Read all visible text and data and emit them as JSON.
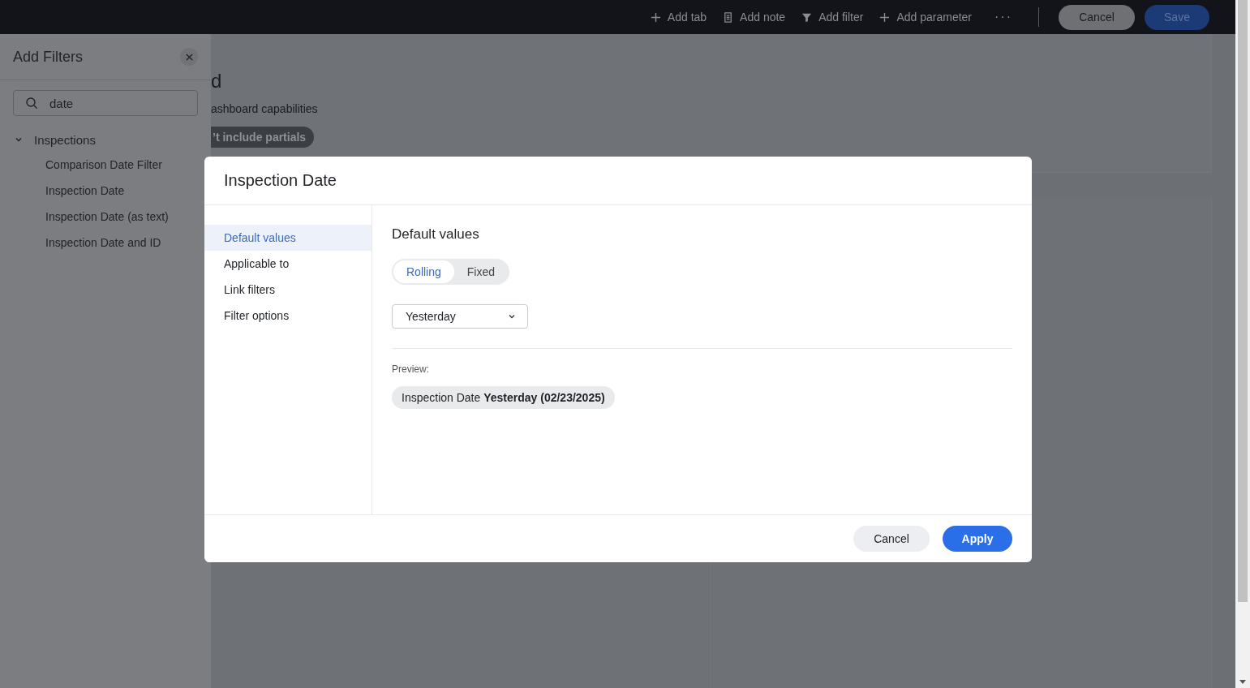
{
  "toolbar": {
    "actions": [
      {
        "kind": "plus",
        "label": "Add tab"
      },
      {
        "kind": "note",
        "label": "Add note"
      },
      {
        "kind": "filter",
        "label": "Add filter"
      },
      {
        "kind": "plus",
        "label": "Add parameter"
      }
    ],
    "more": "···",
    "cancel": "Cancel",
    "save": "Save"
  },
  "sidebar": {
    "title": "Add Filters",
    "search": {
      "value": "date"
    },
    "tree": [
      {
        "label": "Inspections",
        "expanded": true,
        "children": [
          {
            "label": "Comparison Date Filter"
          },
          {
            "label": "Inspection Date"
          },
          {
            "label": "Inspection Date (as text)"
          },
          {
            "label": "Inspection Date and ID"
          }
        ]
      }
    ]
  },
  "background": {
    "heading": "d",
    "subtitle": "ashboard capabilities",
    "chip": "’t include partials"
  },
  "dialog": {
    "title": "Inspection Date",
    "nav": [
      {
        "label": "Default values",
        "selected": true
      },
      {
        "label": "Applicable to",
        "selected": false
      },
      {
        "label": "Link filters",
        "selected": false
      },
      {
        "label": "Filter options",
        "selected": false
      }
    ],
    "section_title": "Default values",
    "modes": [
      {
        "label": "Rolling",
        "selected": true
      },
      {
        "label": "Fixed",
        "selected": false
      }
    ],
    "dropdown": {
      "value": "Yesterday"
    },
    "preview_label": "Preview:",
    "preview_chip": "Inspection Date **Yesterday (02/23/2025)**",
    "buttons": {
      "cancel": "Cancel",
      "apply": "Apply"
    }
  }
}
